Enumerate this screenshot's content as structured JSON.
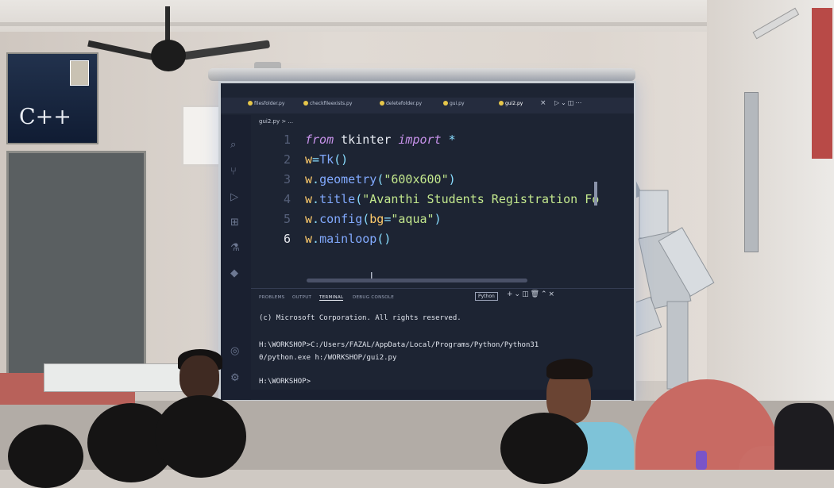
{
  "scene": {
    "poster_left": {
      "title": "C++"
    },
    "editor": {
      "tabs": [
        "filesfolder.py",
        "checkfileexists.py",
        "deletefolder.py",
        "gui.py",
        "gui2.py"
      ],
      "breadcrumb": "gui2.py > ...",
      "lines": [
        {
          "number": "1",
          "tokens": [
            [
              "k",
              "from"
            ],
            [
              "m",
              " tkinter "
            ],
            [
              "k",
              "import"
            ],
            [
              "o",
              " *"
            ]
          ]
        },
        {
          "number": "2",
          "tokens": [
            [
              "p",
              "w"
            ],
            [
              "o",
              "="
            ],
            [
              "f",
              "Tk"
            ],
            [
              "o",
              "()"
            ]
          ]
        },
        {
          "number": "3",
          "tokens": [
            [
              "p",
              "w"
            ],
            [
              "o",
              "."
            ],
            [
              "f",
              "geometry"
            ],
            [
              "o",
              "("
            ],
            [
              "s",
              "\"600x600\""
            ],
            [
              "o",
              ")"
            ]
          ]
        },
        {
          "number": "4",
          "tokens": [
            [
              "p",
              "w"
            ],
            [
              "o",
              "."
            ],
            [
              "f",
              "title"
            ],
            [
              "o",
              "("
            ],
            [
              "s",
              "\"Avanthi Students Registration Fo"
            ]
          ]
        },
        {
          "number": "5",
          "tokens": [
            [
              "p",
              "w"
            ],
            [
              "o",
              "."
            ],
            [
              "f",
              "config"
            ],
            [
              "o",
              "("
            ],
            [
              "p",
              "bg"
            ],
            [
              "o",
              "="
            ],
            [
              "s",
              "\"aqua\""
            ],
            [
              "o",
              ")"
            ]
          ]
        },
        {
          "number": "6",
          "tokens": [
            [
              "p",
              "w"
            ],
            [
              "o",
              "."
            ],
            [
              "f",
              "mainloop"
            ],
            [
              "o",
              "()"
            ]
          ]
        }
      ],
      "active_line": 6
    },
    "panel": {
      "tabs": [
        "PROBLEMS",
        "OUTPUT",
        "TERMINAL",
        "DEBUG CONSOLE"
      ],
      "active_tab": "TERMINAL",
      "python_label": "Python",
      "terminal_lines": [
        "(c) Microsoft Corporation. All rights reserved.",
        "H:\\WORKSHOP>C:/Users/FAZAL/AppData/Local/Programs/Python/Python31",
        "0/python.exe h:/WORKSHOP/gui2.py",
        "H:\\WORKSHOP>"
      ]
    },
    "colors": {
      "editor_bg": "#1d2433",
      "keyword": "#c792ea",
      "function": "#82aaff",
      "string": "#c3e88d",
      "variable": "#ffcb6b"
    },
    "icons": [
      "search-icon",
      "explorer-icon",
      "source-control-icon",
      "run-debug-icon",
      "extensions-icon",
      "testing-icon",
      "python-icon",
      "account-icon",
      "settings-icon"
    ]
  }
}
